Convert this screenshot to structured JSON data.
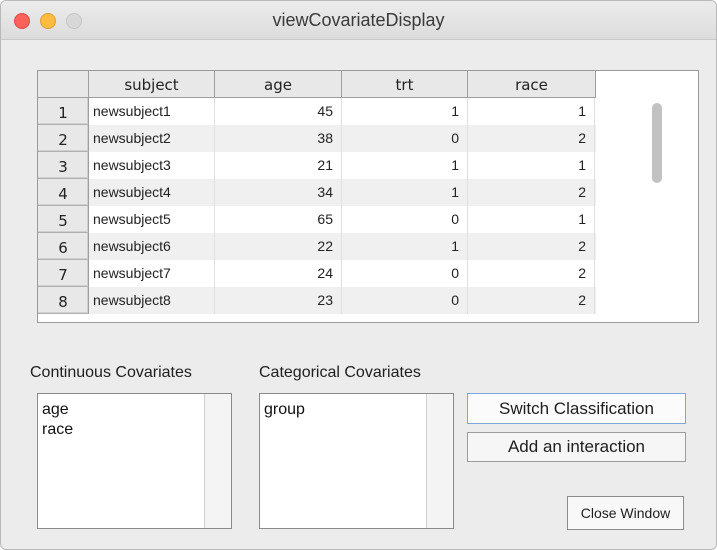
{
  "window": {
    "title": "viewCovariateDisplay"
  },
  "table": {
    "columns": [
      "subject",
      "age",
      "trt",
      "race"
    ],
    "rows": [
      {
        "n": "1",
        "subject": "newsubject1",
        "age": "45",
        "trt": "1",
        "race": "1"
      },
      {
        "n": "2",
        "subject": "newsubject2",
        "age": "38",
        "trt": "0",
        "race": "2"
      },
      {
        "n": "3",
        "subject": "newsubject3",
        "age": "21",
        "trt": "1",
        "race": "1"
      },
      {
        "n": "4",
        "subject": "newsubject4",
        "age": "34",
        "trt": "1",
        "race": "2"
      },
      {
        "n": "5",
        "subject": "newsubject5",
        "age": "65",
        "trt": "0",
        "race": "1"
      },
      {
        "n": "6",
        "subject": "newsubject6",
        "age": "22",
        "trt": "1",
        "race": "2"
      },
      {
        "n": "7",
        "subject": "newsubject7",
        "age": "24",
        "trt": "0",
        "race": "2"
      },
      {
        "n": "8",
        "subject": "newsubject8",
        "age": "23",
        "trt": "0",
        "race": "2"
      }
    ]
  },
  "continuous": {
    "label": "Continuous Covariates",
    "items": [
      "age",
      "race"
    ]
  },
  "categorical": {
    "label": "Categorical Covariates",
    "items": [
      "group"
    ]
  },
  "buttons": {
    "switch_label": "Switch Classification",
    "add_label": "Add an interaction",
    "close_label": "Close Window"
  },
  "colors": {
    "close": "#fc605b",
    "minimize": "#fdbc40",
    "maximize": "#d8d8d8",
    "focus_ring": "#7ea6d8"
  }
}
